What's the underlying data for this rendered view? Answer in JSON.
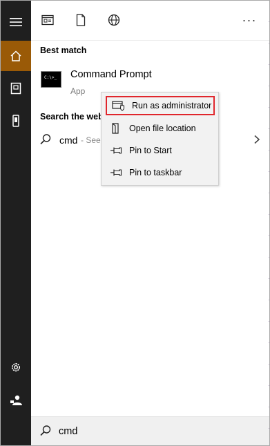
{
  "colors": {
    "rail_bg": "#1f1f1f",
    "rail_active": "#9a5a07",
    "highlight_border": "#e0262c",
    "menu_bg": "#f2f2f2"
  },
  "rail": {
    "items": [
      {
        "icon": "hamburger-menu-icon"
      },
      {
        "icon": "home-icon",
        "active": true
      },
      {
        "icon": "documents-icon"
      },
      {
        "icon": "phone-icon"
      },
      {
        "icon": "settings-gear-icon"
      },
      {
        "icon": "user-account-icon"
      }
    ]
  },
  "toolbar": {
    "icons": [
      "apps-filter-icon",
      "document-filter-icon",
      "web-globe-icon"
    ],
    "more_label": "···"
  },
  "best_match": {
    "heading": "Best match",
    "app_name": "Command Prompt",
    "app_type": "App",
    "app_icon_text": "C:\\>_"
  },
  "web": {
    "heading": "Search the web",
    "query": "cmd",
    "sub": "- See"
  },
  "context_menu": {
    "items": [
      {
        "label": "Run as administrator",
        "icon": "admin-shield-icon",
        "highlighted": true
      },
      {
        "label": "Open file location",
        "icon": "file-location-icon"
      },
      {
        "label": "Pin to Start",
        "icon": "pin-icon"
      },
      {
        "label": "Pin to taskbar",
        "icon": "pin-icon"
      }
    ]
  },
  "searchbox": {
    "value": "cmd"
  }
}
